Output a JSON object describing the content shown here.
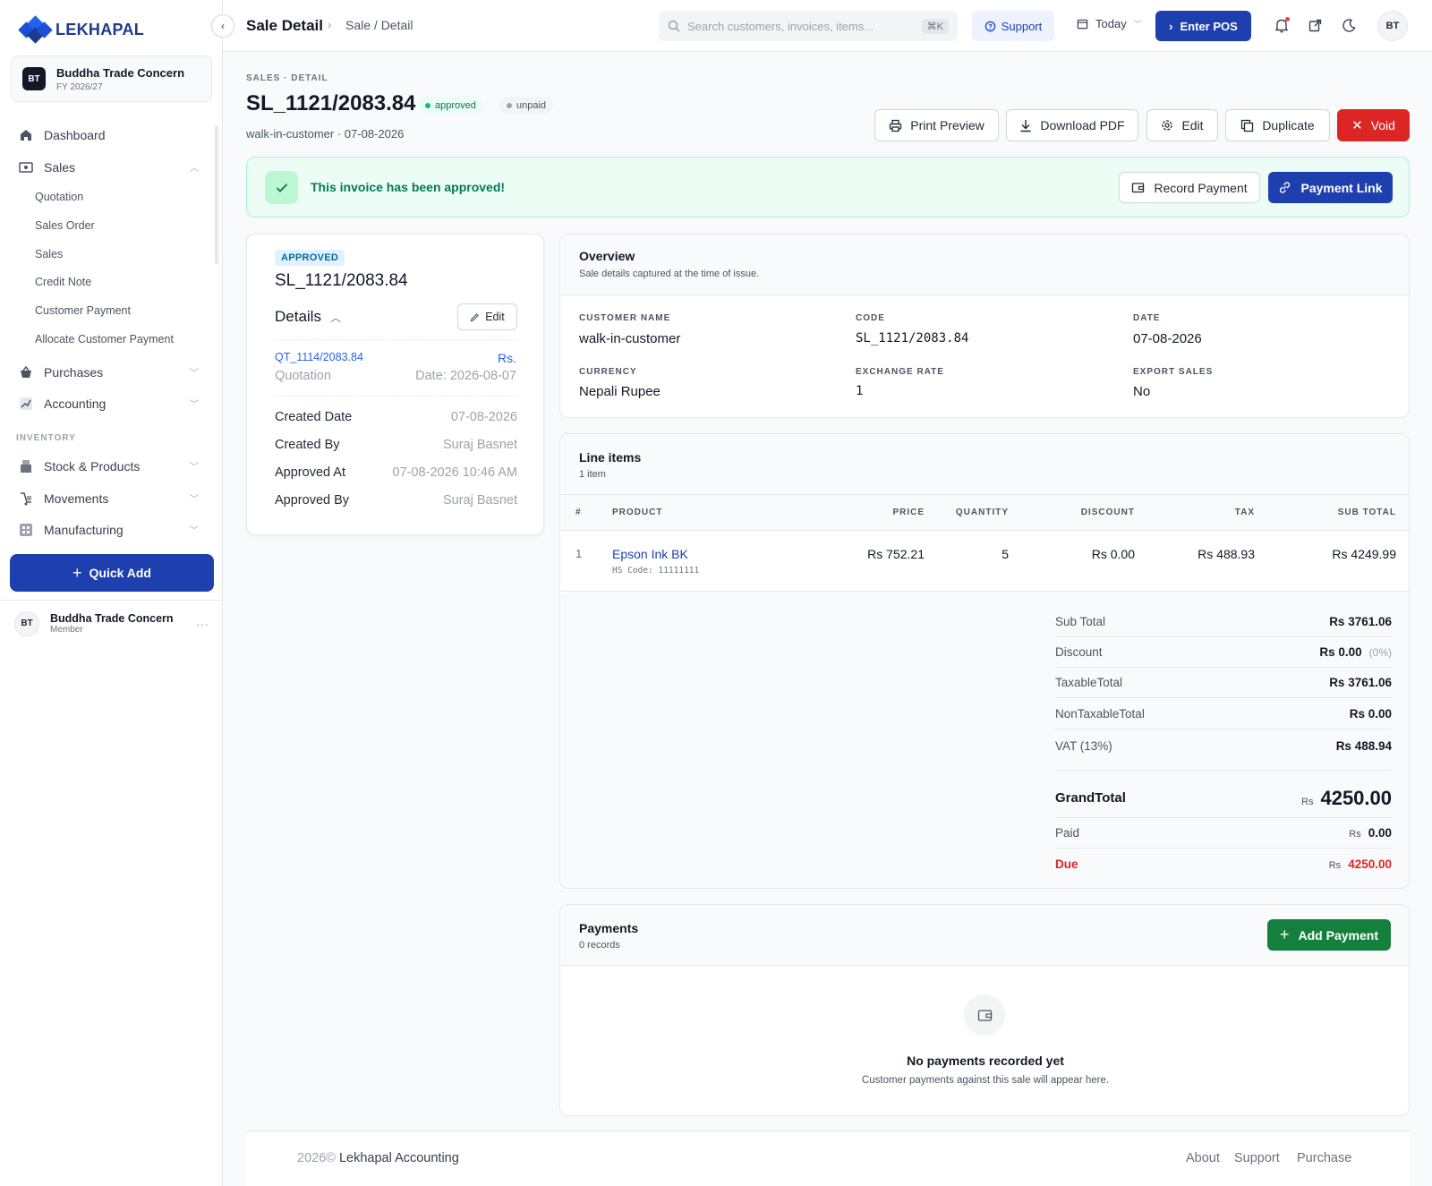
{
  "app": {
    "name": "LEKHAPAL"
  },
  "sidebar": {
    "org": {
      "initials": "BT",
      "name": "Buddha Trade Concern",
      "fy": "FY 2026/27"
    },
    "items": [
      {
        "label": "Dashboard",
        "icon": "home-icon"
      },
      {
        "label": "Sales",
        "icon": "sales-icon",
        "expanded": true
      },
      {
        "label": "Purchases",
        "icon": "basket-icon"
      },
      {
        "label": "Accounting",
        "icon": "chart-icon"
      },
      {
        "label": "Stock & Products",
        "icon": "box-icon"
      },
      {
        "label": "Movements",
        "icon": "truck-icon"
      },
      {
        "label": "Manufacturing",
        "icon": "factory-icon"
      }
    ],
    "sales_sub": [
      "Quotation",
      "Sales Order",
      "Sales",
      "Credit Note",
      "Customer Payment",
      "Allocate Customer Payment"
    ],
    "section_inventory": "INVENTORY",
    "quick_add": "Quick Add",
    "user": {
      "initials": "BT",
      "name": "Buddha Trade Concern",
      "role": "Member"
    }
  },
  "topbar": {
    "title": "Sale Detail",
    "breadcrumb": "Sale / Detail",
    "search_placeholder": "Search customers, invoices, items...",
    "shortcut": "⌘K",
    "support": "Support",
    "today": "Today",
    "enter_pos": "Enter POS",
    "avatar": "BT"
  },
  "header": {
    "kicker": "SALES · DETAIL",
    "title": "SL_1121/2083.84",
    "status_badge": "approved",
    "payment_badge": "unpaid",
    "subtitle": "walk-in-customer · 07-08-2026",
    "actions": {
      "print": "Print Preview",
      "download": "Download PDF",
      "edit": "Edit",
      "duplicate": "Duplicate",
      "void": "Void"
    }
  },
  "banner": {
    "message": "This invoice has been approved!",
    "record_payment": "Record Payment",
    "payment_link": "Payment Link"
  },
  "detail_card": {
    "status": "APPROVED",
    "code": "SL_1121/2083.84",
    "details_label": "Details",
    "edit": "Edit",
    "ref_link": "QT_1114/2083.84",
    "ref_currency": "Rs.",
    "ref_type": "Quotation",
    "ref_date": "Date: 2026-08-07",
    "rows": [
      {
        "label": "Created Date",
        "value": "07-08-2026"
      },
      {
        "label": "Created By",
        "value": "Suraj Basnet"
      },
      {
        "label": "Approved At",
        "value": "07-08-2026 10:46 AM"
      },
      {
        "label": "Approved By",
        "value": "Suraj Basnet"
      }
    ]
  },
  "overview": {
    "title": "Overview",
    "subtitle": "Sale details captured at the time of issue.",
    "fields": [
      {
        "label": "CUSTOMER NAME",
        "value": "walk-in-customer"
      },
      {
        "label": "CODE",
        "value": "SL_1121/2083.84"
      },
      {
        "label": "DATE",
        "value": "07-08-2026"
      },
      {
        "label": "CURRENCY",
        "value": "Nepali Rupee"
      },
      {
        "label": "EXCHANGE RATE",
        "value": "1"
      },
      {
        "label": "EXPORT SALES",
        "value": "No"
      }
    ]
  },
  "line_items": {
    "title": "Line items",
    "count": "1 item",
    "columns": [
      "#",
      "PRODUCT",
      "PRICE",
      "QUANTITY",
      "DISCOUNT",
      "TAX",
      "SUB TOTAL"
    ],
    "rows": [
      {
        "no": "1",
        "product": "Epson Ink BK",
        "hs": "HS Code: 11111111",
        "price": "Rs 752.21",
        "qty": "5",
        "discount": "Rs 0.00",
        "tax": "Rs 488.93",
        "subtotal": "Rs 4249.99"
      }
    ],
    "totals": {
      "sub_total": {
        "label": "Sub Total",
        "value": "Rs 3761.06"
      },
      "discount": {
        "label": "Discount",
        "value": "Rs 0.00",
        "pct": "(0%)"
      },
      "taxable": {
        "label": "TaxableTotal",
        "value": "Rs 3761.06"
      },
      "non_taxable": {
        "label": "NonTaxableTotal",
        "value": "Rs 0.00"
      },
      "vat": {
        "label": "VAT (13%)",
        "value": "Rs 488.94"
      },
      "grand": {
        "label": "GrandTotal",
        "currency": "Rs",
        "value": "4250.00"
      },
      "paid": {
        "label": "Paid",
        "currency": "Rs",
        "value": "0.00"
      },
      "due": {
        "label": "Due",
        "currency": "Rs",
        "value": "4250.00"
      }
    }
  },
  "payments": {
    "title": "Payments",
    "count": "0 records",
    "add": "Add Payment",
    "empty_title": "No payments recorded yet",
    "empty_sub": "Customer payments against this sale will appear here."
  },
  "footer": {
    "year": "2026©",
    "company": "Lekhapal Accounting",
    "links": [
      "About",
      "Support",
      "Purchase"
    ]
  },
  "colors": {
    "primary": "#1e40af",
    "success": "#15803d",
    "danger": "#dc2626",
    "banner_bg": "#ecfdf5"
  }
}
